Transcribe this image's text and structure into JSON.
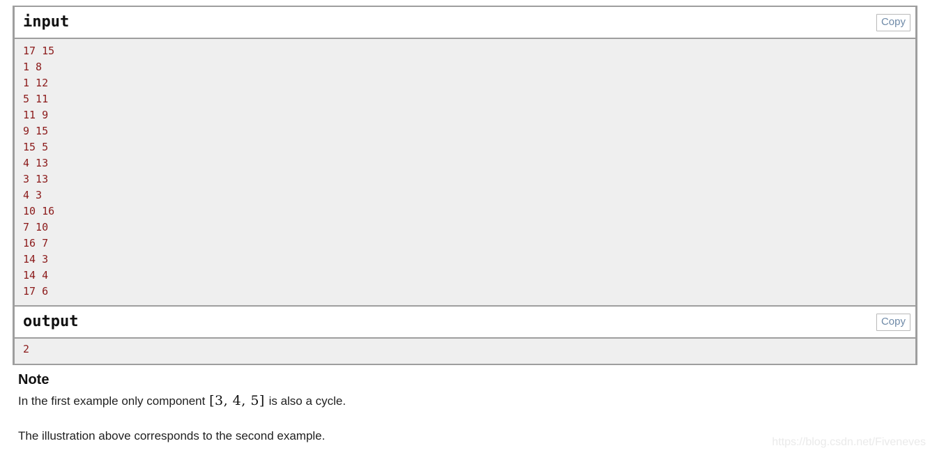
{
  "sample_tests": {
    "input_block": {
      "title": "input",
      "copy_label": "Copy",
      "lines": [
        "17 15",
        "1 8",
        "1 12",
        "5 11",
        "11 9",
        "9 15",
        "15 5",
        "4 13",
        "3 13",
        "4 3",
        "10 16",
        "7 10",
        "16 7",
        "14 3",
        "14 4",
        "17 6"
      ],
      "text": "17 15\n1 8\n1 12\n5 11\n11 9\n9 15\n15 5\n4 13\n3 13\n4 3\n10 16\n7 10\n16 7\n14 3\n14 4\n17 6"
    },
    "output_block": {
      "title": "output",
      "copy_label": "Copy",
      "lines": [
        "2"
      ],
      "text": "2"
    }
  },
  "note": {
    "heading": "Note",
    "paragraph_1_before": "In the first example only component ",
    "paragraph_1_math": "[3, 4, 5]",
    "paragraph_1_after": " is also a cycle.",
    "paragraph_2": "The illustration above corresponds to the second example."
  },
  "watermark": {
    "text": "https://blog.csdn.net/Fiveneves"
  },
  "colors": {
    "code_text": "#8b1a1a",
    "code_background": "#efefef",
    "border": "#9e9e9e",
    "copy_text": "#6f8aa8",
    "watermark": "#eaeaea"
  }
}
